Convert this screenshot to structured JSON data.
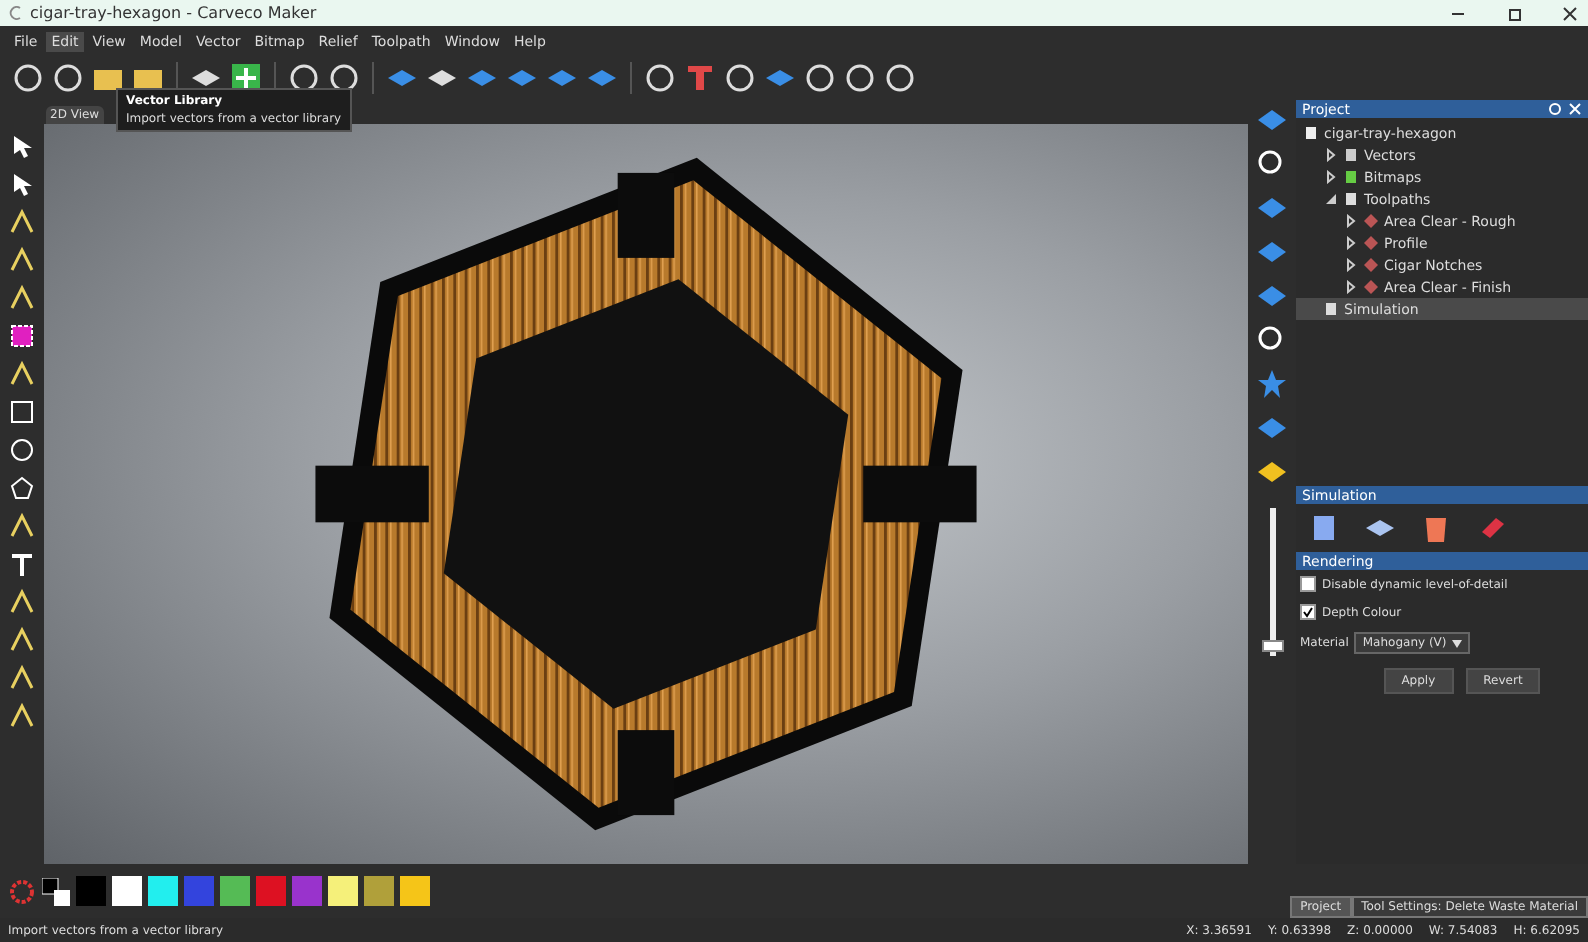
{
  "window": {
    "title": "cigar-tray-hexagon - Carveco Maker"
  },
  "menu": [
    {
      "label": "File",
      "selected": false
    },
    {
      "label": "Edit",
      "selected": true
    },
    {
      "label": "View",
      "selected": false
    },
    {
      "label": "Model",
      "selected": false
    },
    {
      "label": "Vector",
      "selected": false
    },
    {
      "label": "Bitmap",
      "selected": false
    },
    {
      "label": "Relief",
      "selected": false
    },
    {
      "label": "Toolpath",
      "selected": false
    },
    {
      "label": "Window",
      "selected": false
    },
    {
      "label": "Help",
      "selected": false
    }
  ],
  "tooltip": {
    "title": "Vector Library",
    "description": "Import vectors from a vector library"
  },
  "view_tab": {
    "label": "2D View"
  },
  "project": {
    "title": "Project",
    "tree": [
      {
        "label": "cigar-tray-hexagon",
        "kind": "file",
        "children": [
          {
            "label": "Vectors",
            "kind": "vectors",
            "expanded": false,
            "selected": false
          },
          {
            "label": "Bitmaps",
            "kind": "bitmaps",
            "expanded": false,
            "selected": false
          },
          {
            "label": "Toolpaths",
            "kind": "toolpaths",
            "expanded": true,
            "selected": false,
            "children": [
              {
                "label": "Area Clear - Rough",
                "kind": "toolpath",
                "expanded": false,
                "selected": false
              },
              {
                "label": "Profile",
                "kind": "toolpath",
                "expanded": false,
                "selected": false
              },
              {
                "label": "Cigar Notches",
                "kind": "toolpath",
                "expanded": false,
                "selected": false
              },
              {
                "label": "Area Clear - Finish",
                "kind": "toolpath",
                "expanded": false,
                "selected": false
              }
            ]
          },
          {
            "label": "Simulation",
            "kind": "simulation",
            "selected": true
          }
        ]
      }
    ]
  },
  "simulation": {
    "title": "Simulation",
    "section": "Rendering",
    "options": [
      {
        "label": "Disable dynamic level-of-detail",
        "checked": false
      },
      {
        "label": "Depth Colour",
        "checked": true
      }
    ],
    "material_label": "Material",
    "material_value": "Mahogany (V)",
    "buttons": [
      "Apply",
      "Revert"
    ]
  },
  "depth_slider": {
    "level": 0.03
  },
  "palette": [
    {
      "color": "#000000"
    },
    {
      "color": "#ffffff"
    },
    {
      "color": "#22eeee"
    },
    {
      "color": "#3344dd"
    },
    {
      "color": "#55bb55"
    },
    {
      "color": "#dd1122"
    },
    {
      "color": "#9933cc"
    },
    {
      "color": "#f5f07a"
    },
    {
      "color": "#b0a03a"
    },
    {
      "color": "#f5c518"
    }
  ],
  "bottom_tabs": [
    {
      "label": "Project",
      "selected": true
    },
    {
      "label": "Tool Settings: Delete Waste Material",
      "selected": false
    }
  ],
  "status_bar": {
    "message": "Import vectors from a vector library",
    "readouts": [
      "X: 3.36591",
      "Y: 0.63398",
      "Z: 0.00000",
      "W: 7.54083",
      "H: 6.62095"
    ]
  }
}
